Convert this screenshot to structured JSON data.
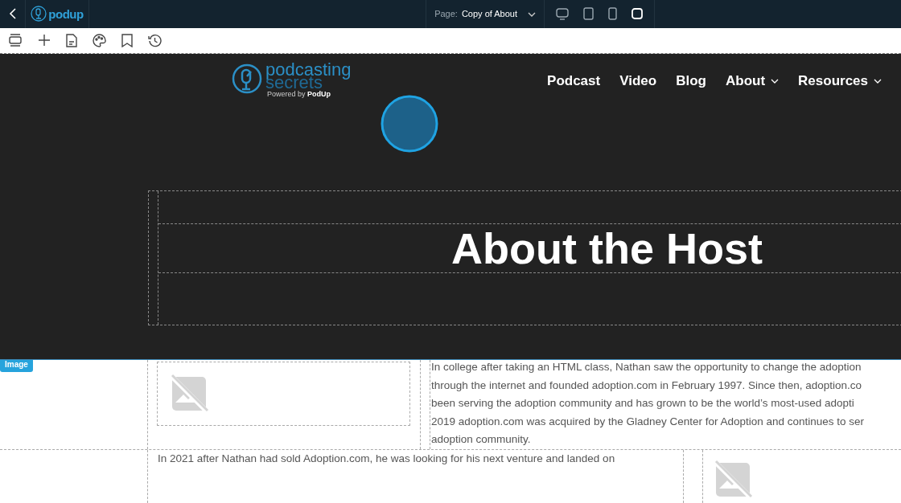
{
  "topbar": {
    "brand": "podup",
    "page_label": "Page:",
    "page_name": "Copy of About",
    "devices": [
      {
        "kind": "desktop",
        "selected": false
      },
      {
        "kind": "tablet",
        "selected": false
      },
      {
        "kind": "phone",
        "selected": false
      },
      {
        "kind": "square",
        "selected": true
      }
    ]
  },
  "site": {
    "logo": {
      "line1": "podcasting",
      "line2": "secrets",
      "powered_prefix": "Powered by",
      "powered_brand": "PodUp"
    },
    "nav": [
      {
        "label": "Podcast",
        "dropdown": false
      },
      {
        "label": "Video",
        "dropdown": false
      },
      {
        "label": "Blog",
        "dropdown": false
      },
      {
        "label": "About",
        "dropdown": true
      },
      {
        "label": "Resources",
        "dropdown": true
      }
    ],
    "heading": "About the Host"
  },
  "selection_tag": "Image",
  "paragraph_1": [
    "In college after taking an HTML class, Nathan saw the opportunity to change the adoption",
    "through the internet and founded adoption.com in February 1997. Since then, adoption.co",
    "been serving the adoption community and has grown to be the world’s most-used adopti",
    "2019 adoption.com was acquired by the Gladney Center for Adoption and continues to ser",
    "adoption community."
  ],
  "paragraph_2": [
    "In 2021 after Nathan had sold Adoption.com, he was looking for his next venture and landed on"
  ]
}
